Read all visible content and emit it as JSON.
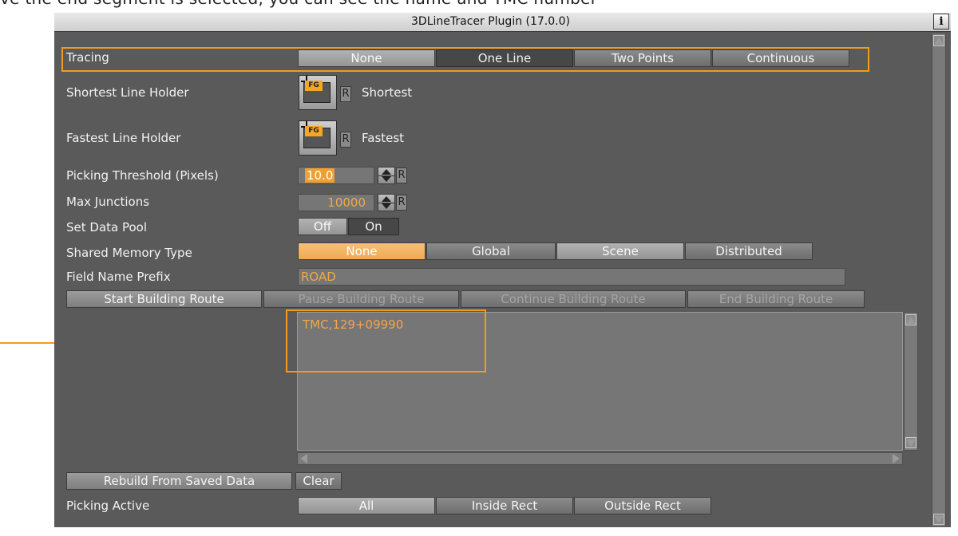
{
  "page_top_text": "ve the end segment is selected, you can see the name and TMC number",
  "window": {
    "title": "3DLineTracer Plugin (17.0.0)",
    "info_glyph": "i"
  },
  "tracing": {
    "label": "Tracing",
    "options": [
      "None",
      "One Line",
      "Two Points",
      "Continuous"
    ],
    "selected": "One Line"
  },
  "shortest": {
    "label": "Shortest Line Holder",
    "tag": "FG",
    "r": "R",
    "name": "Shortest"
  },
  "fastest": {
    "label": "Fastest Line Holder",
    "tag": "FG",
    "r": "R",
    "name": "Fastest"
  },
  "picking_threshold": {
    "label": "Picking Threshold (Pixels)",
    "value": "10.0",
    "r": "R"
  },
  "max_junctions": {
    "label": "Max Junctions",
    "value": "10000",
    "r": "R"
  },
  "data_pool": {
    "label": "Set Data Pool",
    "off": "Off",
    "on": "On",
    "selected": "On"
  },
  "shared_memory": {
    "label": "Shared  Memory Type",
    "options": [
      "None",
      "Global",
      "Scene",
      "Distributed"
    ],
    "selected": "None"
  },
  "field_prefix": {
    "label": "Field Name Prefix",
    "value": "ROAD"
  },
  "route_buttons": {
    "start": "Start Building Route",
    "pause": "Pause Building Route",
    "continue": "Continue Building Route",
    "end": "End Building Route"
  },
  "output_text": "TMC,129+09990",
  "rebuild_label": "Rebuild From Saved Data",
  "clear_label": "Clear",
  "picking_active": {
    "label": "Picking Active",
    "options": [
      "All",
      "Inside Rect",
      "Outside Rect"
    ],
    "selected": "All"
  },
  "colors": {
    "accent": "#f39a1e",
    "panel_bg": "#5a5a5a",
    "orange_button": "#eeaa55"
  }
}
